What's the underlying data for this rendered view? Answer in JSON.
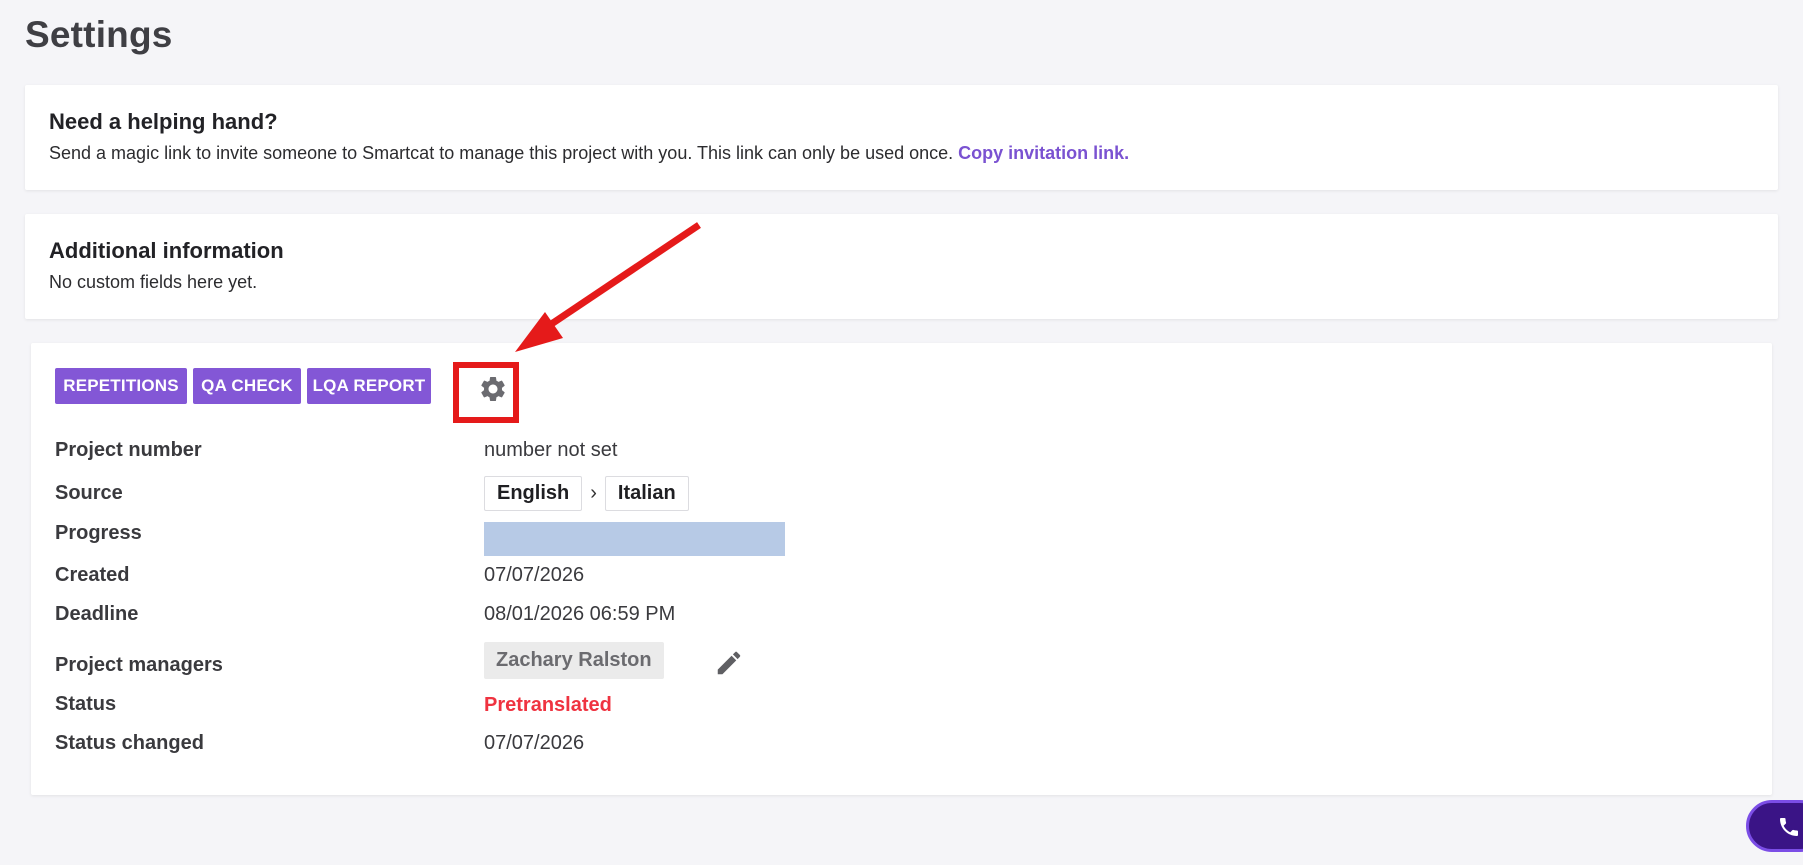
{
  "page": {
    "title": "Settings"
  },
  "help_card": {
    "heading": "Need a helping hand?",
    "text": "Send a magic link to invite someone to Smartcat to manage this project with you. This link can only be used once. ",
    "link_label": "Copy invitation link."
  },
  "additional_info": {
    "heading": "Additional information",
    "text": "No custom fields here yet."
  },
  "toolbar": {
    "buttons": [
      {
        "label": "REPETITIONS"
      },
      {
        "label": "QA CHECK"
      },
      {
        "label": "LQA REPORT"
      }
    ],
    "settings_icon": "gear-icon"
  },
  "details": {
    "project_number": {
      "label": "Project number",
      "value": "number not set"
    },
    "source": {
      "label": "Source",
      "from": "English",
      "separator": "›",
      "to": "Italian"
    },
    "progress": {
      "label": "Progress",
      "value_fraction": 1.0
    },
    "created": {
      "label": "Created",
      "value": "07/07/2026"
    },
    "deadline": {
      "label": "Deadline",
      "value": "08/01/2026 06:59 PM"
    },
    "managers": {
      "label": "Project managers",
      "names": [
        "Zachary Ralston"
      ],
      "edit_icon": "pencil-icon"
    },
    "status": {
      "label": "Status",
      "value": "Pretranslated"
    },
    "status_changed": {
      "label": "Status changed",
      "value": "07/07/2026"
    }
  },
  "colors": {
    "accent": "#8357d6",
    "link": "#7a52d1",
    "status_red": "#ef3340",
    "annotation_red": "#e51a1a",
    "progress_fill": "#b7cae6"
  },
  "widgets": {
    "call_icon": "phone-icon"
  }
}
